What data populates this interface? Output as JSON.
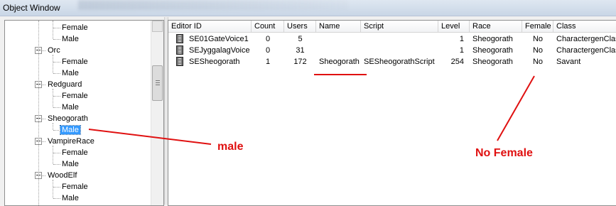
{
  "window": {
    "title": "Object Window"
  },
  "tree": {
    "items": [
      {
        "label": "Female",
        "level": 2
      },
      {
        "label": "Male",
        "level": 2
      },
      {
        "label": "Orc",
        "level": 1
      },
      {
        "label": "Female",
        "level": 2
      },
      {
        "label": "Male",
        "level": 2
      },
      {
        "label": "Redguard",
        "level": 1
      },
      {
        "label": "Female",
        "level": 2
      },
      {
        "label": "Male",
        "level": 2
      },
      {
        "label": "Sheogorath",
        "level": 1
      },
      {
        "label": "Male",
        "level": 2,
        "selected": true
      },
      {
        "label": "VampireRace",
        "level": 1
      },
      {
        "label": "Female",
        "level": 2
      },
      {
        "label": "Male",
        "level": 2
      },
      {
        "label": "WoodElf",
        "level": 1
      },
      {
        "label": "Female",
        "level": 2
      },
      {
        "label": "Male",
        "level": 2
      }
    ]
  },
  "table": {
    "columns": [
      "Editor ID",
      "Count",
      "Users",
      "Name",
      "Script",
      "Level",
      "Race",
      "Female",
      "Class"
    ],
    "rows": [
      [
        "SE01GateVoice1",
        "0",
        "5",
        "",
        "",
        "1",
        "Sheogorath",
        "No",
        "CharactergenClass"
      ],
      [
        "SEJyggalagVoice",
        "0",
        "31",
        "",
        "",
        "1",
        "Sheogorath",
        "No",
        "CharactergenClass"
      ],
      [
        "SESheogorath",
        "1",
        "172",
        "Sheogorath",
        "SESheogorathScript",
        "254",
        "Sheogorath",
        "No",
        "Savant"
      ]
    ]
  },
  "annotations": {
    "male_label": "male",
    "female_label": "No Female",
    "color": "#e01010"
  }
}
